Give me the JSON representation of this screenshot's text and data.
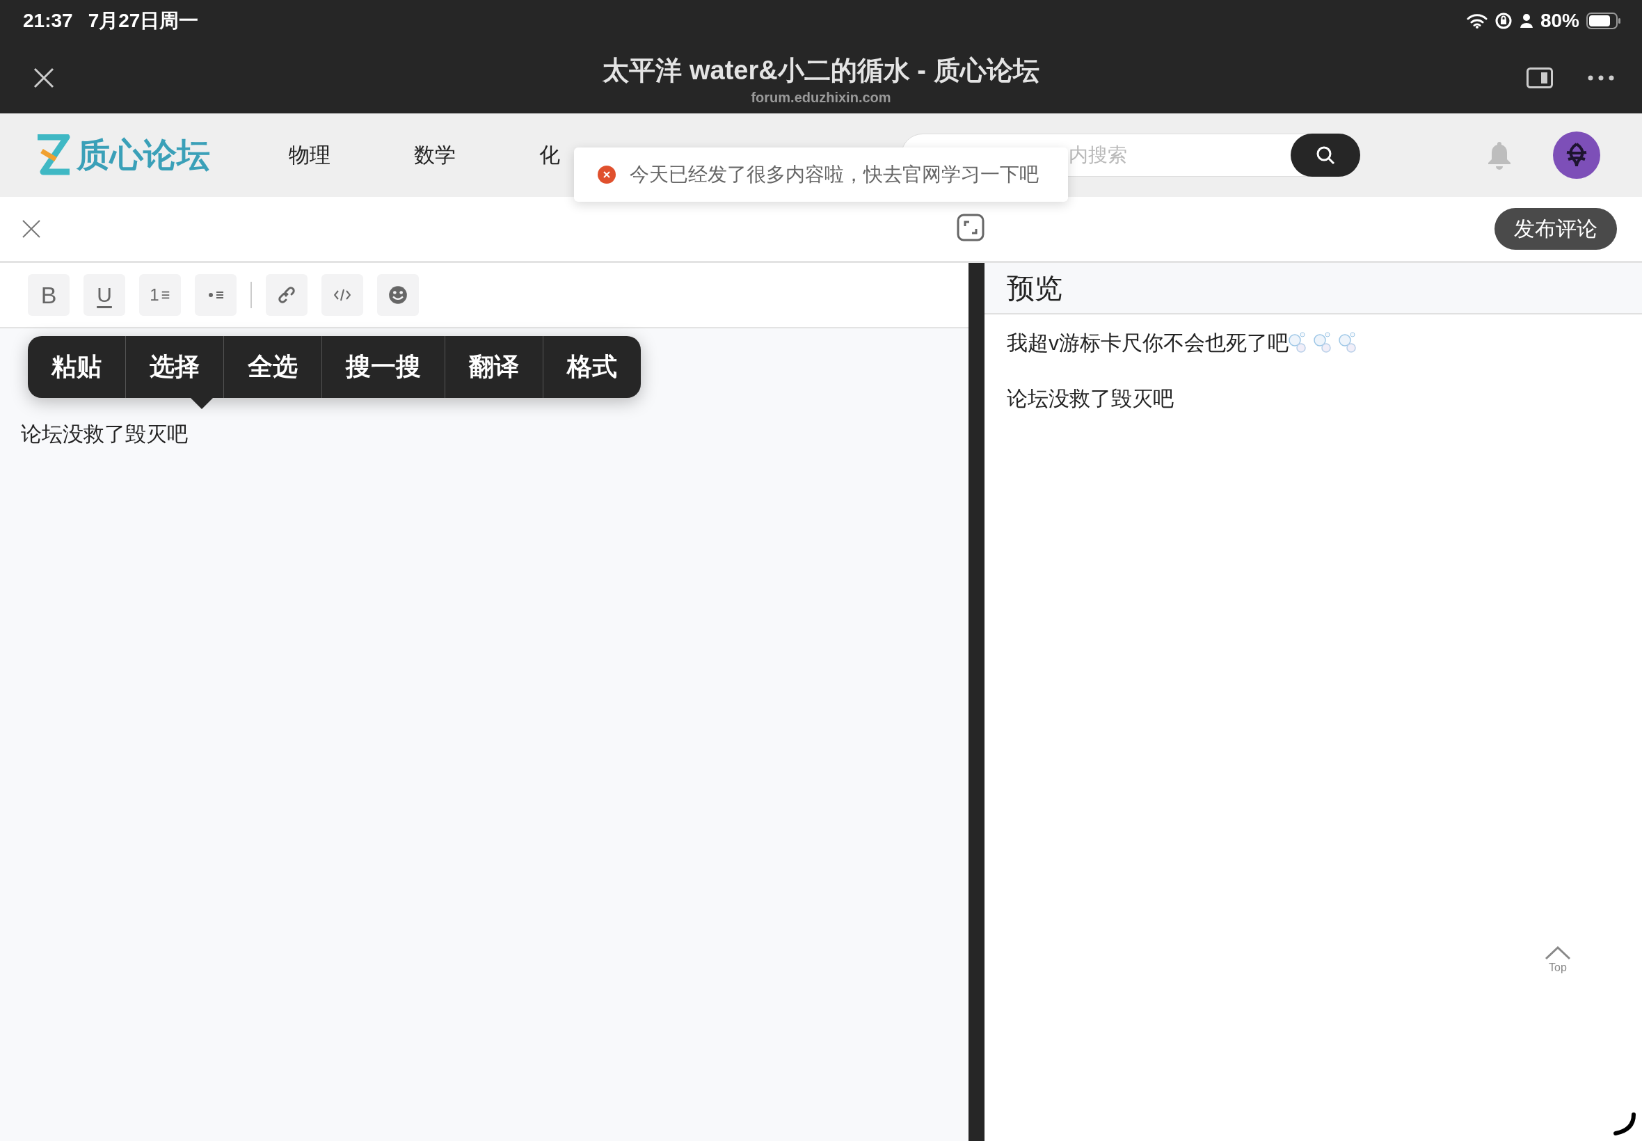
{
  "status_bar": {
    "time": "21:37",
    "date": "7月27日周一",
    "battery": "80%"
  },
  "browser": {
    "title": "太平洋 water&小二的循水 - 质心论坛",
    "url": "forum.eduzhixin.com"
  },
  "site": {
    "logo": "质心论坛",
    "nav": [
      {
        "label": "物理"
      },
      {
        "label": "数学"
      },
      {
        "label": "化"
      }
    ],
    "search": {
      "placeholder": "内搜索"
    }
  },
  "toast": {
    "kind": "error",
    "message": "今天已经发了很多内容啦，快去官网学习一下吧"
  },
  "editor": {
    "publish_button": "发布评论",
    "toolbar": [
      {
        "kind": "bold",
        "label": "B"
      },
      {
        "kind": "underline",
        "label": "U"
      },
      {
        "kind": "ordered_list",
        "label": "1"
      },
      {
        "kind": "bullet_list"
      },
      {
        "kind": "separator"
      },
      {
        "kind": "link"
      },
      {
        "kind": "code"
      },
      {
        "kind": "emoji"
      }
    ],
    "lines": [
      "论坛没救了毁灭吧"
    ]
  },
  "context_menu": [
    "粘贴",
    "选择",
    "全选",
    "搜一搜",
    "翻译",
    "格式"
  ],
  "preview": {
    "title": "预览",
    "lines": [
      {
        "text": "我超v游标卡尺你不会也死了吧",
        "kind": "with_emoji"
      },
      {
        "text": "论坛没救了毁灭吧",
        "kind": "plain"
      }
    ]
  },
  "top_button": "Top"
}
